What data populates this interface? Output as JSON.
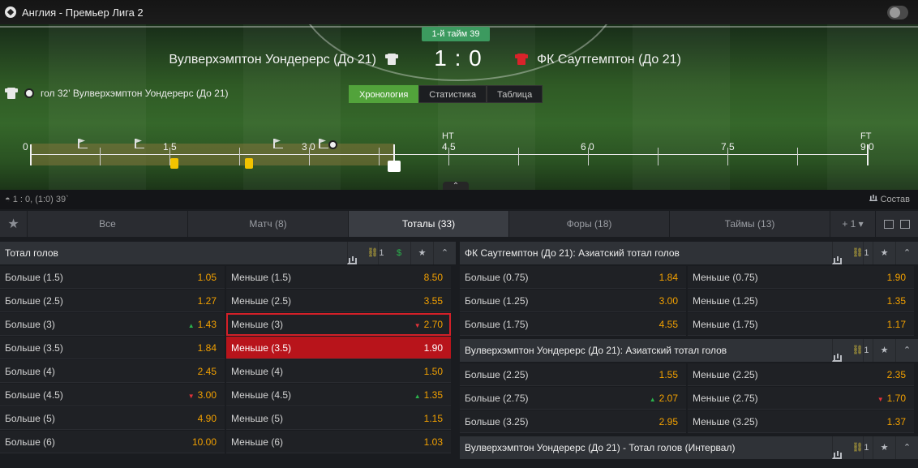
{
  "header": {
    "league": "Англия - Премьер Лига 2",
    "period": "1-й тайм 39",
    "home_team": "Вулверхэмптон Уондерерс (До 21)",
    "away_team": "ФК Саутгемптон (До 21)",
    "score": "1 : 0",
    "last_event": "гол 32' Вулверхэмптон Уондерерс (До 21)",
    "view_tabs": [
      "Хронология",
      "Статистика",
      "Таблица"
    ],
    "active_view_tab": "Хронология"
  },
  "timeline": {
    "labels": [
      "0",
      "1 5",
      "3 0",
      "4 5",
      "6 0",
      "7 5",
      "9 0"
    ],
    "ht": "HT",
    "ft": "FT",
    "current_minute": 39
  },
  "info": {
    "score_line": "1 : 0, (1:0) 39`",
    "lineup": "Состав"
  },
  "market_tabs": [
    {
      "label": "Все"
    },
    {
      "label": "Матч (8)"
    },
    {
      "label": "Тоталы (33)"
    },
    {
      "label": "Форы (18)"
    },
    {
      "label": "Таймы (13)"
    }
  ],
  "market_tabs_more": "+ 1  ▾",
  "panels": {
    "total_goals": {
      "title": "Тотал голов",
      "link_count": "1",
      "rows": [
        {
          "over": "Больше (1.5)",
          "over_odd": "1.05",
          "under": "Меньше (1.5)",
          "under_odd": "8.50"
        },
        {
          "over": "Больше (2.5)",
          "over_odd": "1.27",
          "under": "Меньше (2.5)",
          "under_odd": "3.55"
        },
        {
          "over": "Больше (3)",
          "over_odd": "1.43",
          "under": "Меньше (3)",
          "under_odd": "2.70"
        },
        {
          "over": "Больше (3.5)",
          "over_odd": "1.84",
          "under": "Меньше (3.5)",
          "under_odd": "1.90"
        },
        {
          "over": "Больше (4)",
          "over_odd": "2.45",
          "under": "Меньше (4)",
          "under_odd": "1.50"
        },
        {
          "over": "Больше (4.5)",
          "over_odd": "3.00",
          "under": "Меньше (4.5)",
          "under_odd": "1.35"
        },
        {
          "over": "Больше (5)",
          "over_odd": "4.90",
          "under": "Меньше (5)",
          "under_odd": "1.15"
        },
        {
          "over": "Больше (6)",
          "over_odd": "10.00",
          "under": "Меньше (6)",
          "under_odd": "1.03"
        }
      ]
    },
    "away_asian": {
      "title": "ФК Саутгемптон (До 21): Азиатский тотал голов",
      "link_count": "1",
      "rows": [
        {
          "over": "Больше (0.75)",
          "over_odd": "1.84",
          "under": "Меньше (0.75)",
          "under_odd": "1.90"
        },
        {
          "over": "Больше (1.25)",
          "over_odd": "3.00",
          "under": "Меньше (1.25)",
          "under_odd": "1.35"
        },
        {
          "over": "Больше (1.75)",
          "over_odd": "4.55",
          "under": "Меньше (1.75)",
          "under_odd": "1.17"
        }
      ]
    },
    "home_asian": {
      "title": "Вулверхэмптон Уондерерс (До 21): Азиатский тотал голов",
      "link_count": "1",
      "rows": [
        {
          "over": "Больше (2.25)",
          "over_odd": "1.55",
          "under": "Меньше (2.25)",
          "under_odd": "2.35"
        },
        {
          "over": "Больше (2.75)",
          "over_odd": "2.07",
          "under": "Меньше (2.75)",
          "under_odd": "1.70"
        },
        {
          "over": "Больше (3.25)",
          "over_odd": "2.95",
          "under": "Меньше (3.25)",
          "under_odd": "1.37"
        }
      ]
    },
    "home_interval": {
      "title": "Вулверхэмптон Уондерерс (До 21) - Тотал голов (Интервал)",
      "link_count": "1"
    }
  },
  "colors": {
    "accent_green": "#52a33b",
    "odds_orange": "#f2a000",
    "selected_red": "#b8141b"
  }
}
